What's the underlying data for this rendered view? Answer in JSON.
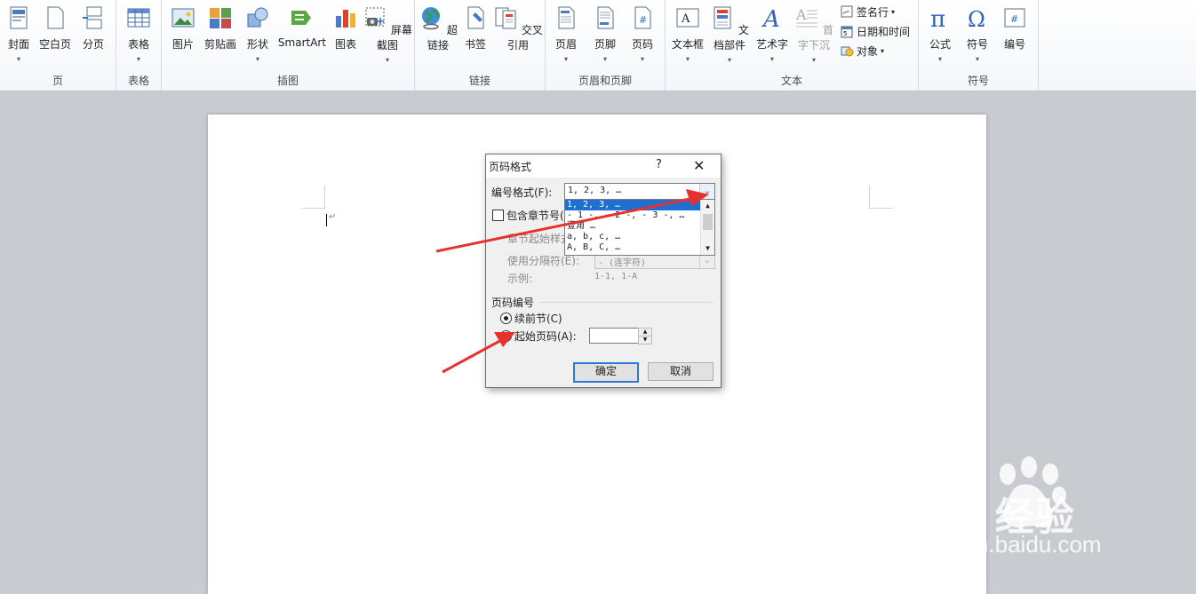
{
  "ribbon": {
    "groups": [
      {
        "label": "页",
        "buttons": [
          "封面",
          "空白页",
          "分页"
        ]
      },
      {
        "label": "表格",
        "buttons": [
          "表格"
        ]
      },
      {
        "label": "插图",
        "buttons": [
          "图片",
          "剪贴画",
          "形状",
          "SmartArt",
          "图表",
          "屏幕截图"
        ]
      },
      {
        "label": "链接",
        "buttons": [
          "超链接",
          "书签",
          "交叉引用"
        ]
      },
      {
        "label": "页眉和页脚",
        "buttons": [
          "页眉",
          "页脚",
          "页码"
        ]
      },
      {
        "label": "文本",
        "buttons": [
          "文本框",
          "文档部件",
          "艺术字",
          "首字下沉"
        ],
        "small": [
          "签名行",
          "日期和时间",
          "对象"
        ]
      },
      {
        "label": "符号",
        "buttons": [
          "公式",
          "符号",
          "编号"
        ]
      }
    ]
  },
  "dialog": {
    "title": "页码格式",
    "help": "?",
    "close": "✕",
    "number_format_label": "编号格式(F):",
    "number_format_value": "1, 2, 3, …",
    "dropdown_options": [
      "1, 2, 3, …",
      "- 1 -, - 2 -, - 3 -, …",
      "壹角 …",
      "a, b, c, …",
      "A, B, C, …"
    ],
    "include_chapter_label": "包含章节号(",
    "chapter_start_label": "章节起始样式",
    "separator_label": "使用分隔符(E):",
    "separator_value": "-  (连字符)",
    "example_label": "示例:",
    "example_value": "1-1, 1-A",
    "page_numbering_label": "页码编号",
    "continue_label": "续前节(C)",
    "start_at_label": "起始页码(A):",
    "start_at_value": "",
    "ok": "确定",
    "cancel": "取消"
  },
  "document": {
    "paragraph_mark": "↵"
  },
  "watermark": {
    "line1": "Bai 经验",
    "line2": "jingyan.baidu.com"
  },
  "colors": {
    "accent": "#1e6fd0",
    "arrow": "#e8302e",
    "page_bg": "#c8cbd0"
  }
}
